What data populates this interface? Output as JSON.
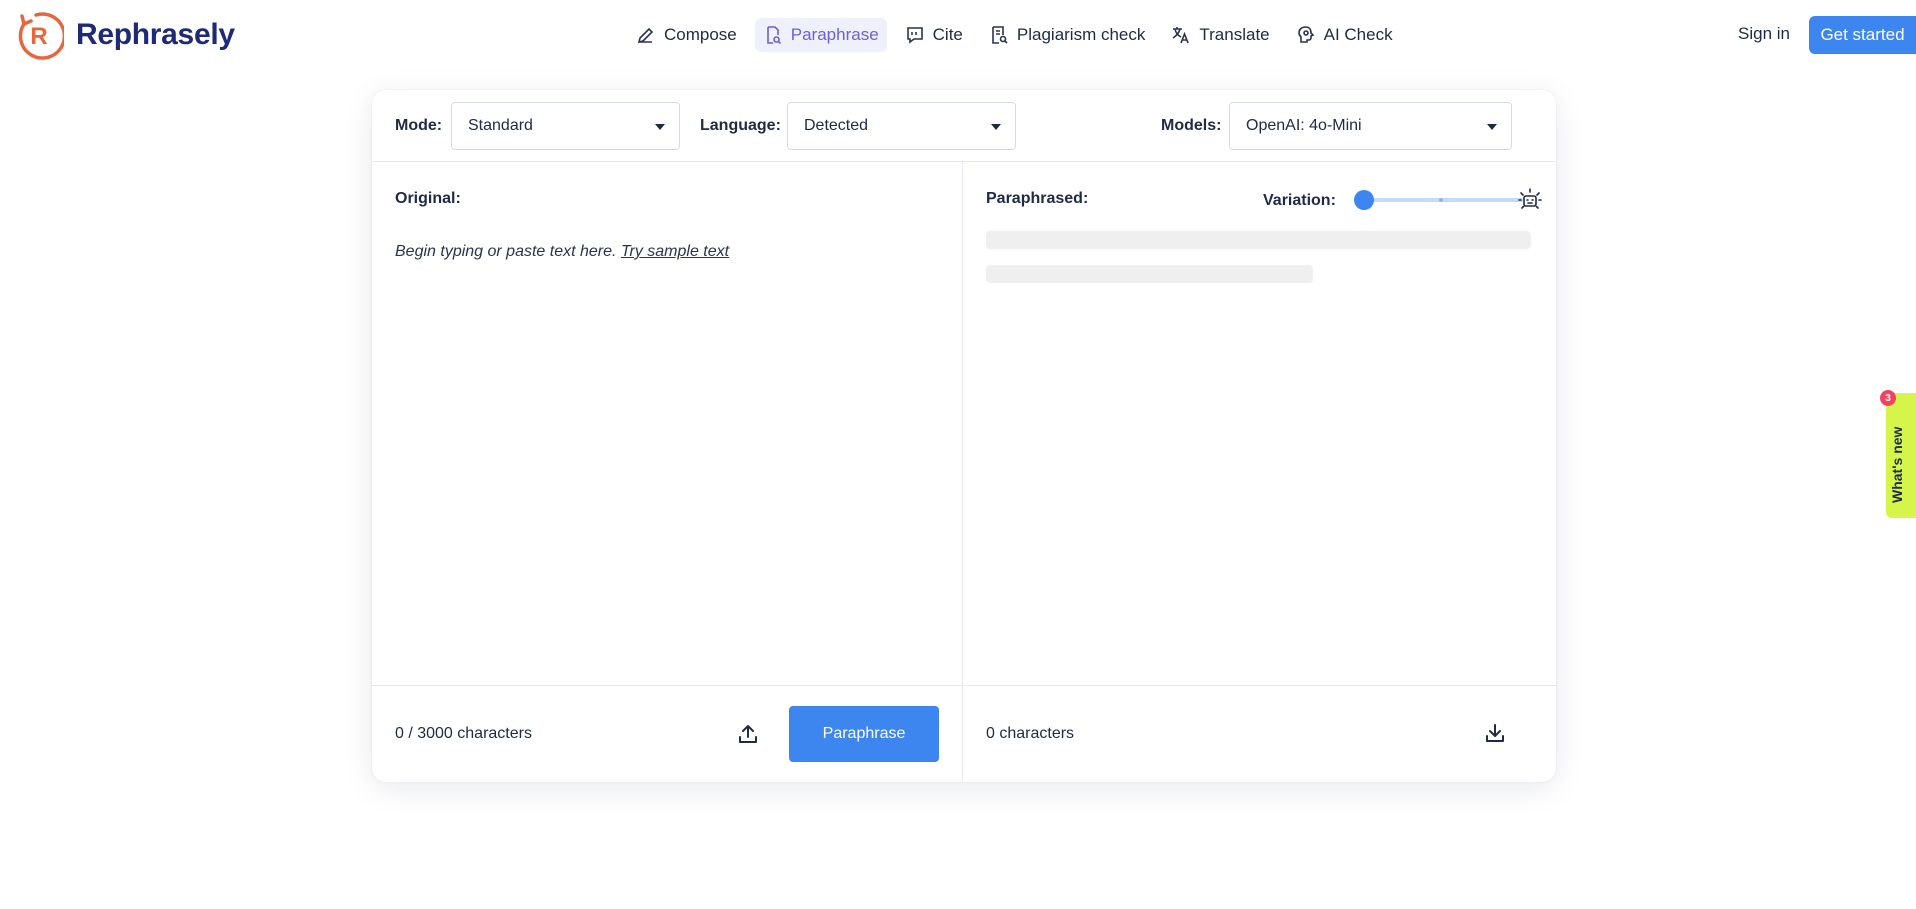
{
  "brand": {
    "name": "Rephrasely",
    "logo_letter": "R",
    "accent": "#e8663d",
    "brand_color": "#1e2a78"
  },
  "nav": {
    "items": [
      {
        "label": "Compose",
        "icon": "pencil-icon"
      },
      {
        "label": "Paraphrase",
        "icon": "document-search-icon",
        "active": true
      },
      {
        "label": "Cite",
        "icon": "quote-bubble-icon"
      },
      {
        "label": "Plagiarism check",
        "icon": "document-check-icon"
      },
      {
        "label": "Translate",
        "icon": "translate-icon"
      },
      {
        "label": "AI Check",
        "icon": "brain-icon"
      }
    ],
    "sign_in": "Sign in",
    "get_started": "Get started"
  },
  "toolbar": {
    "mode_label": "Mode:",
    "mode_value": "Standard",
    "language_label": "Language:",
    "language_value": "Detected",
    "models_label": "Models:",
    "models_value": "OpenAI: 4o-Mini"
  },
  "original": {
    "title": "Original:",
    "placeholder": "Begin typing or paste text here.",
    "sample_link": "Try sample text",
    "char_count": "0 / 3000 characters",
    "paraphrase_button": "Paraphrase"
  },
  "paraphrased": {
    "title": "Paraphrased:",
    "variation_label": "Variation:",
    "variation_level": 0,
    "char_count": "0 characters"
  },
  "whats_new": {
    "label": "What's new",
    "badge": "3"
  },
  "colors": {
    "primary": "#3d86f0",
    "active_nav": "#6d5fd6",
    "whats_new_bg": "#d6f54a",
    "badge": "#f0445f"
  }
}
